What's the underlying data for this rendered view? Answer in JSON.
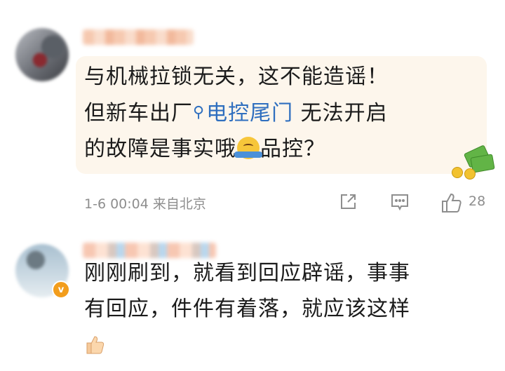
{
  "comments": [
    {
      "body_line1": "与机械拉锁无关，这不能造谣！",
      "body_line2_before": "但新车出厂",
      "topic_icon": "search-icon",
      "topic": "电控尾门",
      "body_line2_after": " 无法开启",
      "body_line3_before": "的故障是事实哦",
      "emoji": "shrug-face-emoji",
      "body_line3_after": "品控？",
      "sticker": "money-sticker",
      "timestamp": "1-6 00:04 来自北京",
      "like_count": "28"
    },
    {
      "verified_badge": "v",
      "body_line1": "刚刚刷到，就看到回应辟谣，事事",
      "body_line2": "有回应，件件有着落，就应该这样",
      "emoji": "thumbs-up-emoji"
    }
  ]
}
